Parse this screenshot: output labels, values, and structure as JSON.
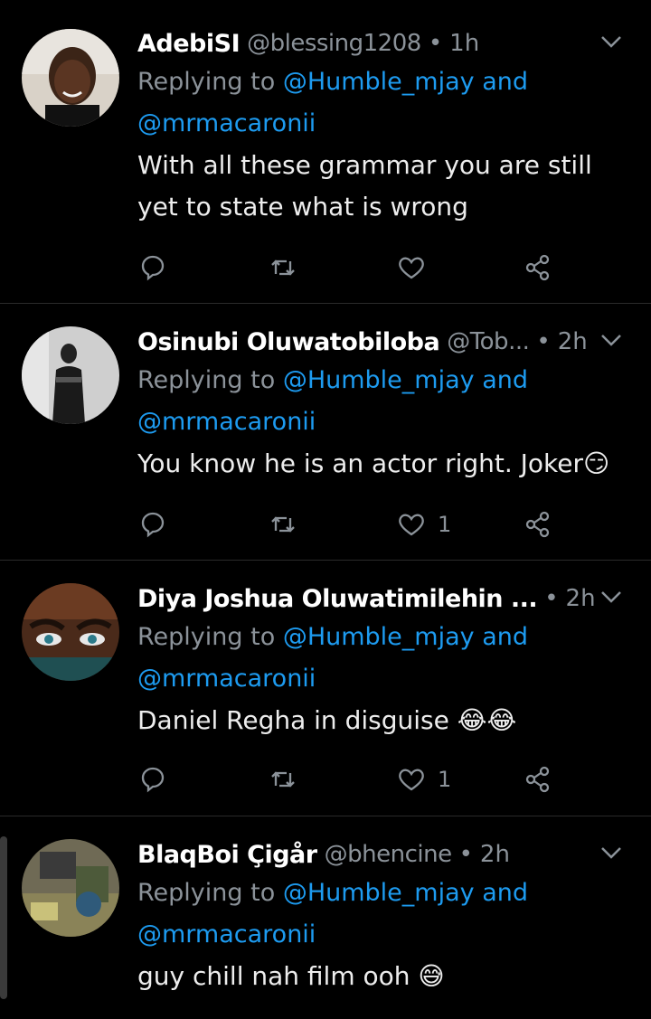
{
  "tweets": [
    {
      "name": "AdebiSI",
      "handle": "@blessing1208",
      "time": "1h",
      "replying_prefix": "Replying to ",
      "mention1": "@Humble_mjay",
      "and": " and",
      "mention2": "@mrmacaronii",
      "text_line1": "With all these grammar you are still",
      "text_line2": "yet to state what is wrong",
      "likes": ""
    },
    {
      "name": "Osinubi Oluwatobiloba",
      "handle": "@Tob...",
      "time": "2h",
      "replying_prefix": "Replying to ",
      "mention1": "@Humble_mjay",
      "and": " and",
      "mention2": "@mrmacaronii",
      "text_line1": "You know he is an actor right. Joker😏",
      "text_line2": "",
      "likes": "1"
    },
    {
      "name": "Diya Joshua Oluwatimilehin ...",
      "handle": "",
      "time": "2h",
      "replying_prefix": "Replying to ",
      "mention1": "@Humble_mjay",
      "and": " and",
      "mention2": "@mrmacaronii",
      "text_line1": "Daniel Regha in disguise 😂😂",
      "text_line2": "",
      "likes": "1"
    },
    {
      "name": "BlaqBoi Çigår",
      "handle": "@bhencine",
      "time": "2h",
      "replying_prefix": "Replying to ",
      "mention1": "@Humble_mjay",
      "and": " and",
      "mention2": "@mrmacaronii",
      "text_line1": "guy chill nah film ooh 😅",
      "text_line2": "",
      "likes": ""
    }
  ],
  "colors": {
    "background": "#000000",
    "link": "#1d9bf0",
    "muted": "#8b9299",
    "divider": "#2a2a2a"
  }
}
